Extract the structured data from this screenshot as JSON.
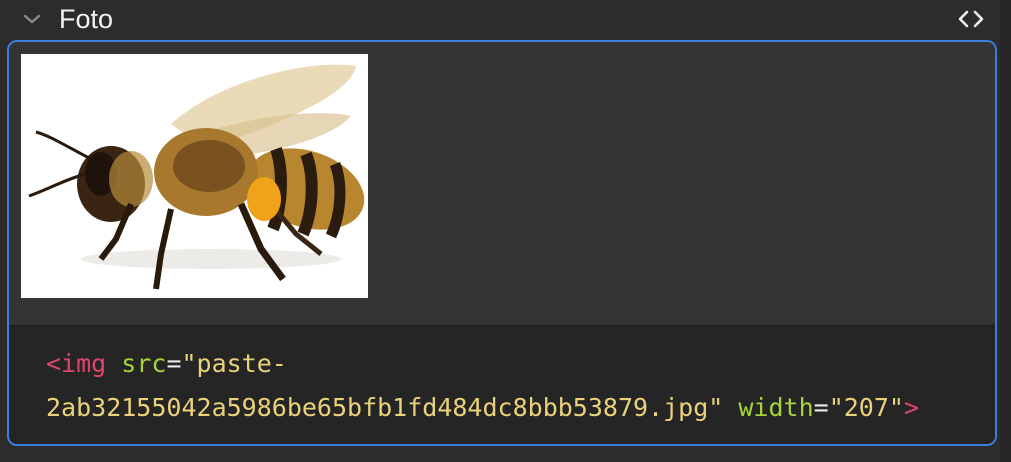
{
  "field": {
    "title": "Foto",
    "collapse_icon": "chevron-down-icon",
    "code_toggle_icon": "code-brackets-icon"
  },
  "image": {
    "alt_subject": "bee"
  },
  "code": {
    "line1": {
      "tag_open": "<img",
      "attr1": "src",
      "eq1": "=",
      "val1_part1": "\"paste-"
    },
    "line2": {
      "val1_part2": "2ab32155042a5986be65bfb1fd484dc8bbb53879.jpg\"",
      "attr2": "width",
      "eq2": "=",
      "val2": "\"207\"",
      "tag_close": ">"
    }
  },
  "colors": {
    "accent_border": "#3a7fe0",
    "tag": "#e0446b",
    "attr": "#a3d43a",
    "string": "#e9d27a"
  }
}
